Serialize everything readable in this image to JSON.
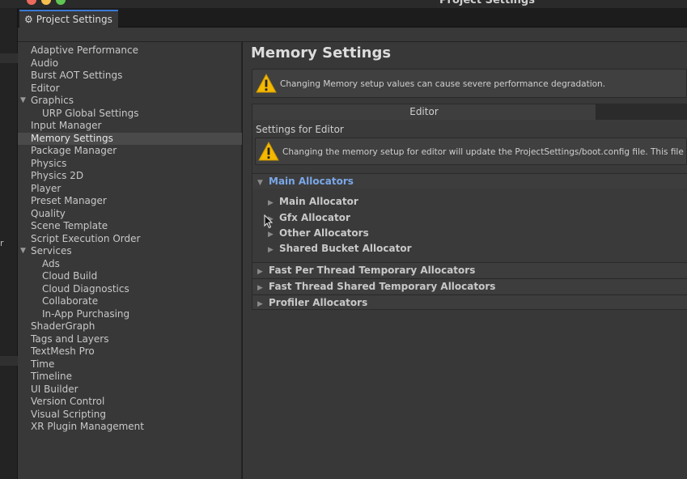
{
  "window": {
    "title": "Project Settings"
  },
  "tab": {
    "label": "Project Settings",
    "icon": "gear-icon"
  },
  "sidebar": {
    "items": [
      {
        "label": "Adaptive Performance",
        "level": 0
      },
      {
        "label": "Audio",
        "level": 0
      },
      {
        "label": "Burst AOT Settings",
        "level": 0
      },
      {
        "label": "Editor",
        "level": 0
      },
      {
        "label": "Graphics",
        "level": 0,
        "expanded": true
      },
      {
        "label": "URP Global Settings",
        "level": 1
      },
      {
        "label": "Input Manager",
        "level": 0
      },
      {
        "label": "Memory Settings",
        "level": 0,
        "selected": true
      },
      {
        "label": "Package Manager",
        "level": 0
      },
      {
        "label": "Physics",
        "level": 0
      },
      {
        "label": "Physics 2D",
        "level": 0
      },
      {
        "label": "Player",
        "level": 0
      },
      {
        "label": "Preset Manager",
        "level": 0
      },
      {
        "label": "Quality",
        "level": 0
      },
      {
        "label": "Scene Template",
        "level": 0
      },
      {
        "label": "Script Execution Order",
        "level": 0
      },
      {
        "label": "Services",
        "level": 0,
        "expanded": true
      },
      {
        "label": "Ads",
        "level": 1
      },
      {
        "label": "Cloud Build",
        "level": 1
      },
      {
        "label": "Cloud Diagnostics",
        "level": 1
      },
      {
        "label": "Collaborate",
        "level": 1
      },
      {
        "label": "In-App Purchasing",
        "level": 1
      },
      {
        "label": "ShaderGraph",
        "level": 0
      },
      {
        "label": "Tags and Layers",
        "level": 0
      },
      {
        "label": "TextMesh Pro",
        "level": 0
      },
      {
        "label": "Time",
        "level": 0
      },
      {
        "label": "Timeline",
        "level": 0
      },
      {
        "label": "UI Builder",
        "level": 0
      },
      {
        "label": "Version Control",
        "level": 0
      },
      {
        "label": "Visual Scripting",
        "level": 0
      },
      {
        "label": "XR Plugin Management",
        "level": 0
      }
    ]
  },
  "main": {
    "title": "Memory Settings",
    "warning1": "Changing Memory setup values can cause severe performance degradation.",
    "tabs": [
      {
        "label": "Editor",
        "active": true
      },
      {
        "label": "",
        "active": false
      }
    ],
    "settings_for": "Settings for Editor",
    "warning2": "Changing the memory setup for editor will update the ProjectSettings/boot.config file. This file is loaded at E",
    "main_allocators": "Main Allocators",
    "sub_allocators": [
      "Main Allocator",
      "Gfx Allocator",
      "Other Allocators",
      "Shared Bucket Allocator"
    ],
    "other_foldouts": [
      "Fast Per Thread Temporary Allocators",
      "Fast Thread Shared Temporary Allocators",
      "Profiler Allocators"
    ]
  },
  "left_strip": {
    "char": "r"
  },
  "colors": {
    "accent": "#3a79d6",
    "warning": "#f5b800",
    "foldout_blue": "#7aa7e8"
  }
}
